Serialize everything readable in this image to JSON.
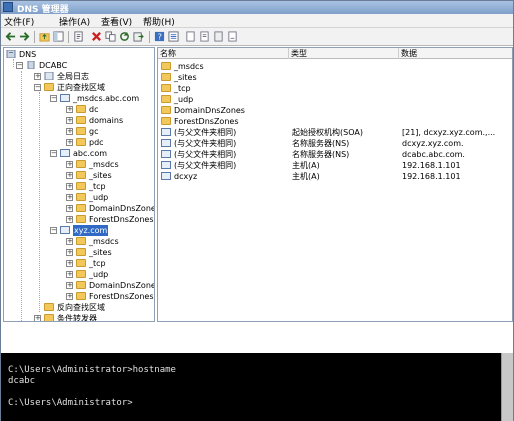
{
  "window": {
    "title": "DNS 管理器"
  },
  "menu": [
    "文件(F)",
    "操作(A)",
    "查看(V)",
    "帮助(H)"
  ],
  "tree": {
    "root": "DNS",
    "server": "DCABC",
    "global_log": "全局日志",
    "forward_zones": "正向查找区域",
    "msdcs_zone": "_msdcs.abc.com",
    "msdcs_children": [
      "dc",
      "domains",
      "gc",
      "pdc"
    ],
    "abc_zone": "abc.com",
    "abc_children": [
      "_msdcs",
      "_sites",
      "_tcp",
      "_udp",
      "DomainDnsZones",
      "ForestDnsZones"
    ],
    "xyz_zone": "xyz.com",
    "xyz_children": [
      "_msdcs",
      "_sites",
      "_tcp",
      "_udp",
      "DomainDnsZones",
      "ForestDnsZones"
    ],
    "reverse_zones": "反向查找区域",
    "conditional_forwarders": "条件转发器"
  },
  "list": {
    "columns": [
      "名称",
      "类型",
      "数据"
    ],
    "rows": [
      {
        "name": "_msdcs",
        "type": "",
        "data": "",
        "icon": "folder"
      },
      {
        "name": "_sites",
        "type": "",
        "data": "",
        "icon": "folder"
      },
      {
        "name": "_tcp",
        "type": "",
        "data": "",
        "icon": "folder"
      },
      {
        "name": "_udp",
        "type": "",
        "data": "",
        "icon": "folder"
      },
      {
        "name": "DomainDnsZones",
        "type": "",
        "data": "",
        "icon": "folder"
      },
      {
        "name": "ForestDnsZones",
        "type": "",
        "data": "",
        "icon": "folder"
      },
      {
        "name": "(与父文件夹相同)",
        "type": "起始授权机构(SOA)",
        "data": "[21], dcxyz.xyz.com.,...",
        "icon": "record"
      },
      {
        "name": "(与父文件夹相同)",
        "type": "名称服务器(NS)",
        "data": "dcxyz.xyz.com.",
        "icon": "record"
      },
      {
        "name": "(与父文件夹相同)",
        "type": "名称服务器(NS)",
        "data": "dcabc.abc.com.",
        "icon": "record"
      },
      {
        "name": "(与父文件夹相同)",
        "type": "主机(A)",
        "data": "192.168.1.101",
        "icon": "record"
      },
      {
        "name": "dcxyz",
        "type": "主机(A)",
        "data": "192.168.1.101",
        "icon": "record"
      }
    ]
  },
  "console": {
    "lines": [
      "C:\\Users\\Administrator>hostname",
      "dcabc",
      "",
      "C:\\Users\\Administrator>"
    ]
  },
  "colors": {
    "selection": "#316ac5",
    "folder": "#f3c85a",
    "console_bg": "#000000"
  }
}
